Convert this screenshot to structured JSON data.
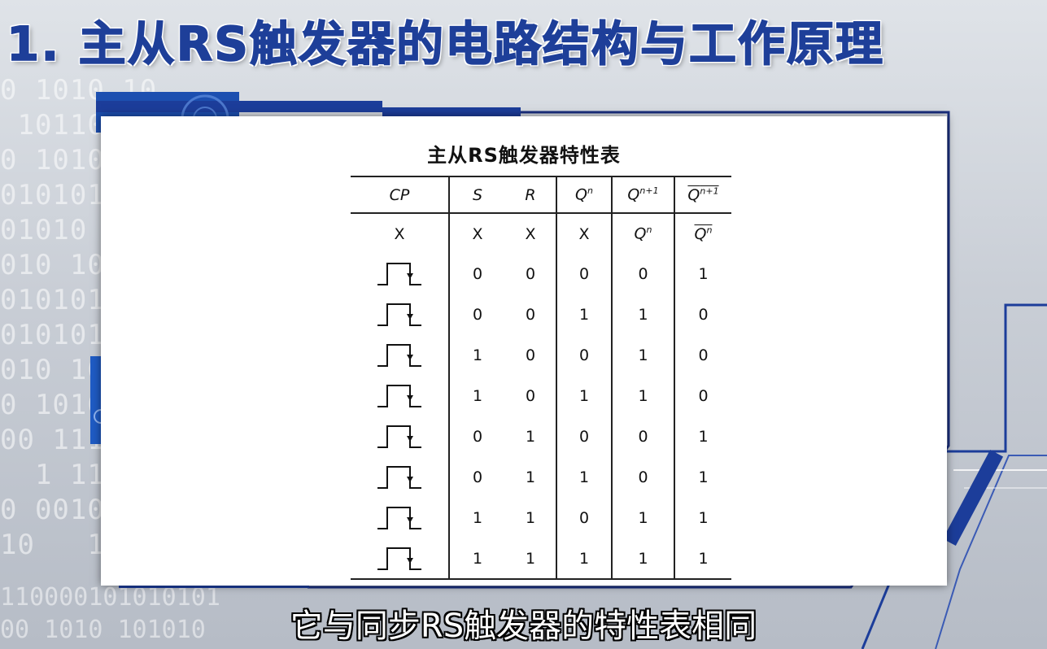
{
  "title": "1. 主从RS触发器的电路结构与工作原理",
  "subtitle": "它与同步RS触发器的特性表相同",
  "table": {
    "caption": "主从RS触发器特性表",
    "headers": {
      "cp": "CP",
      "s": "S",
      "r": "R",
      "q": "Q",
      "q_sup": "n",
      "qn1": "Q",
      "qn1_sup": "n+1",
      "qbar": "Q",
      "qbar_sup": "n+1"
    },
    "first_row": {
      "cp": "X",
      "s": "X",
      "r": "X",
      "q": "X",
      "qn1": "Q",
      "qn1_sup": "n",
      "qbar": "Q",
      "qbar_sup": "n"
    },
    "rows": [
      {
        "cp": "pulse-icon",
        "s": "0",
        "r": "0",
        "q": "0",
        "qn1": "0",
        "qbar": "1"
      },
      {
        "cp": "pulse-icon",
        "s": "0",
        "r": "0",
        "q": "1",
        "qn1": "1",
        "qbar": "0"
      },
      {
        "cp": "pulse-icon",
        "s": "1",
        "r": "0",
        "q": "0",
        "qn1": "1",
        "qbar": "0"
      },
      {
        "cp": "pulse-icon",
        "s": "1",
        "r": "0",
        "q": "1",
        "qn1": "1",
        "qbar": "0"
      },
      {
        "cp": "pulse-icon",
        "s": "0",
        "r": "1",
        "q": "0",
        "qn1": "0",
        "qbar": "1"
      },
      {
        "cp": "pulse-icon",
        "s": "0",
        "r": "1",
        "q": "1",
        "qn1": "0",
        "qbar": "1"
      },
      {
        "cp": "pulse-icon",
        "s": "1",
        "r": "1",
        "q": "0",
        "qn1": "1",
        "qbar": "1"
      },
      {
        "cp": "pulse-icon",
        "s": "1",
        "r": "1",
        "q": "1",
        "qn1": "1",
        "qbar": "1"
      }
    ]
  },
  "colors": {
    "title": "#1e3f99",
    "accent_blue": "#1c3d9a",
    "frame_line": "#1a2f80"
  }
}
